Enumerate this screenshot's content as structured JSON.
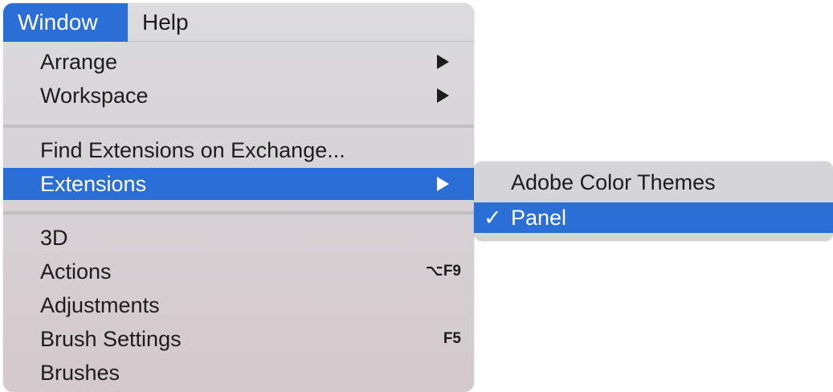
{
  "menubar": {
    "items": [
      {
        "label": "Window",
        "active": true
      },
      {
        "label": "Help",
        "active": false
      }
    ]
  },
  "window_menu": {
    "group1": [
      {
        "label": "Arrange",
        "submenu": true
      },
      {
        "label": "Workspace",
        "submenu": true
      }
    ],
    "group2": [
      {
        "label": "Find Extensions on Exchange..."
      },
      {
        "label": "Extensions",
        "submenu": true,
        "highlighted": true
      }
    ],
    "group3": [
      {
        "label": "3D"
      },
      {
        "label": "Actions",
        "shortcut": "⌥F9"
      },
      {
        "label": "Adjustments"
      },
      {
        "label": "Brush Settings",
        "shortcut": "F5"
      },
      {
        "label": "Brushes"
      }
    ]
  },
  "extensions_submenu": {
    "items": [
      {
        "label": "Adobe Color Themes",
        "checked": false
      },
      {
        "label": "Panel",
        "checked": true,
        "highlighted": true,
        "check_mark": "✓"
      }
    ]
  },
  "colors": {
    "highlight": "#2b6fd6",
    "menu_background": "#d8d6d9",
    "text": "#1c1c1c"
  },
  "icons": {
    "submenu_arrow": "submenu-arrow-icon",
    "check": "checkmark-icon"
  }
}
